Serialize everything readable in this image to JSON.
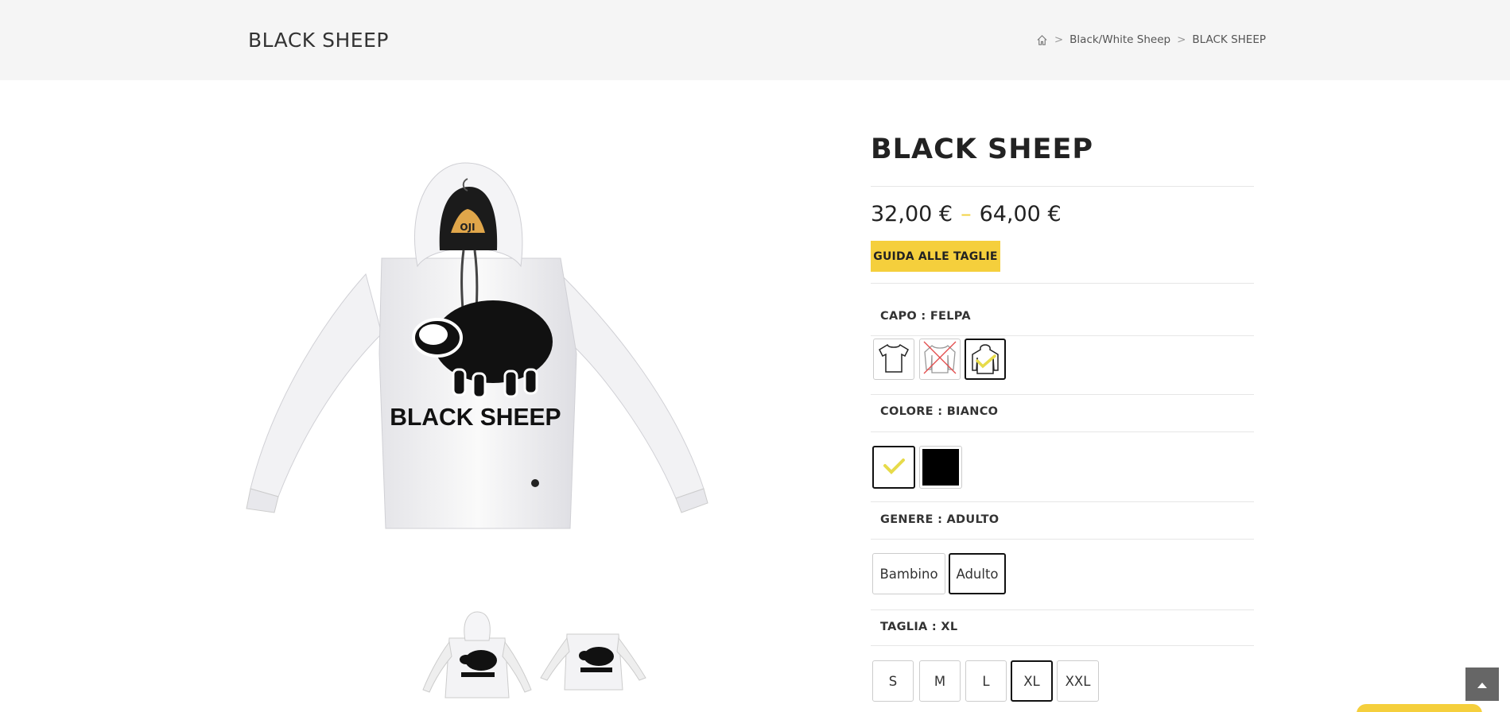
{
  "header": {
    "title": "BLACK SHEEP",
    "breadcrumb": [
      {
        "label": "Black/White Sheep"
      },
      {
        "label": "BLACK SHEEP"
      }
    ],
    "separator": ">"
  },
  "product": {
    "title": "BLACK SHEEP",
    "price_min": "32,00 €",
    "price_dash": "–",
    "price_max": "64,00 €",
    "size_guide_label": "GUIDA ALLE TAGLIE",
    "print_text": "BLACK SHEEP",
    "hanger_text": "OJI"
  },
  "attributes": {
    "capo": {
      "label": "CAPO",
      "colon": " : ",
      "value": "FELPA",
      "options": [
        "t-shirt-icon",
        "sweatshirt-icon",
        "hoodie-icon"
      ]
    },
    "colore": {
      "label": "COLORE",
      "colon": " : ",
      "value": "BIANCO",
      "options": [
        "Bianco",
        "Nero"
      ]
    },
    "genere": {
      "label": "GENERE",
      "colon": " : ",
      "value": "ADULTO",
      "options": [
        "Bambino",
        "Adulto"
      ]
    },
    "taglia": {
      "label": "TAGLIA",
      "colon": " : ",
      "value": "XL",
      "options": [
        "S",
        "M",
        "L",
        "XL",
        "XXL"
      ]
    }
  },
  "colors": {
    "accent": "#f5cf3c",
    "header_bg": "#f5f5f5",
    "text": "#333333"
  }
}
